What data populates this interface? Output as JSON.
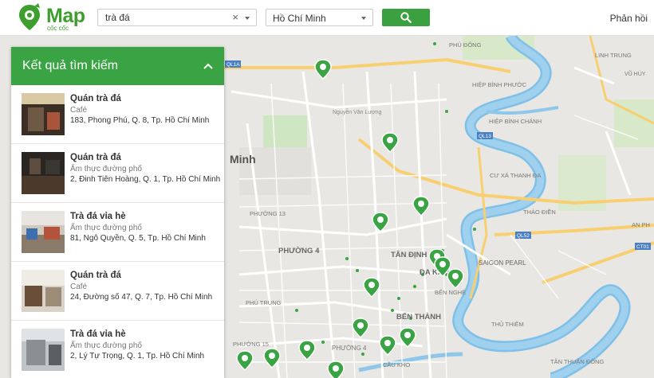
{
  "brand": {
    "name": "Map",
    "sub": "cốc cốc"
  },
  "search": {
    "query": "trà đá",
    "clear_glyph": "×"
  },
  "city": {
    "selected": "Hồ Chí Minh"
  },
  "header": {
    "feedback": "Phản hồi"
  },
  "panel": {
    "title": "Kết quả tìm kiếm",
    "results": [
      {
        "name": "Quán trà đá",
        "category": "Café",
        "address": "183, Phong Phú, Q. 8, Tp. Hồ Chí Minh"
      },
      {
        "name": "Quán trà đá",
        "category": "Ẩm thực đường phố",
        "address": "2, Đinh Tiên Hoàng, Q. 1, Tp. Hồ Chí Minh"
      },
      {
        "name": "Trà đá vỉa hè",
        "category": "Ẩm thực đường phố",
        "address": "81, Ngô Quyền, Q. 5, Tp. Hồ Chí Minh"
      },
      {
        "name": "Quán trà đá",
        "category": "Café",
        "address": "24, Đường số 47, Q. 7, Tp. Hồ Chí Minh"
      },
      {
        "name": "Trà đá vỉa hè",
        "category": "Ẩm thực đường phố",
        "address": "2, Lý Tự Trọng, Q. 1, Tp. Hồ Chí Minh"
      }
    ]
  },
  "map": {
    "labels": {
      "phu_dong": "PHÚ ĐÔNG",
      "linh_trung": "LINH TRUNG",
      "vu_huy": "VŨ HÙY",
      "hiep_binh_phuoc": "HIỆP BÌNH PHƯỚC",
      "hiep_binh_chanh": "HIỆP BÌNH CHÁNH",
      "cu_xa_thanh_da": "CƯ XÁ THANH ĐA",
      "thao_dien": "THẢO ĐIỀN",
      "an_phu": "AN PH",
      "saigon_pearl": "SAIGON PEARL",
      "tan_dinh": "TÂN ĐỊNH",
      "da_kao": "ĐA KAO",
      "ben_nghe": "BẾN NGHÉ",
      "ben_thanh": "BẾN THÀNH",
      "phuong_4": "PHƯỜNG 4",
      "phuong_4b": "PHƯỜNG 4",
      "phuong_13": "PHƯỜNG 13",
      "phu_trung": "PHÚ TRUNG",
      "phuong_15": "PHƯỜNG 15",
      "cau_kho": "CẦU KHO",
      "thu_thiem": "THỦ THIÊM",
      "tan_thuan": "TÂN THUẬN\nĐÔNG",
      "minh": "Minh",
      "nguyen_van_luong": "Nguyễn Văn Lượng",
      "ql1a": "QL1A",
      "ql13": "QL13",
      "ql52": "QL52",
      "ct01": "CT01"
    },
    "pin_color": "#3aa444"
  },
  "colors": {
    "accent": "#3aa444",
    "water": "#78bce6"
  }
}
